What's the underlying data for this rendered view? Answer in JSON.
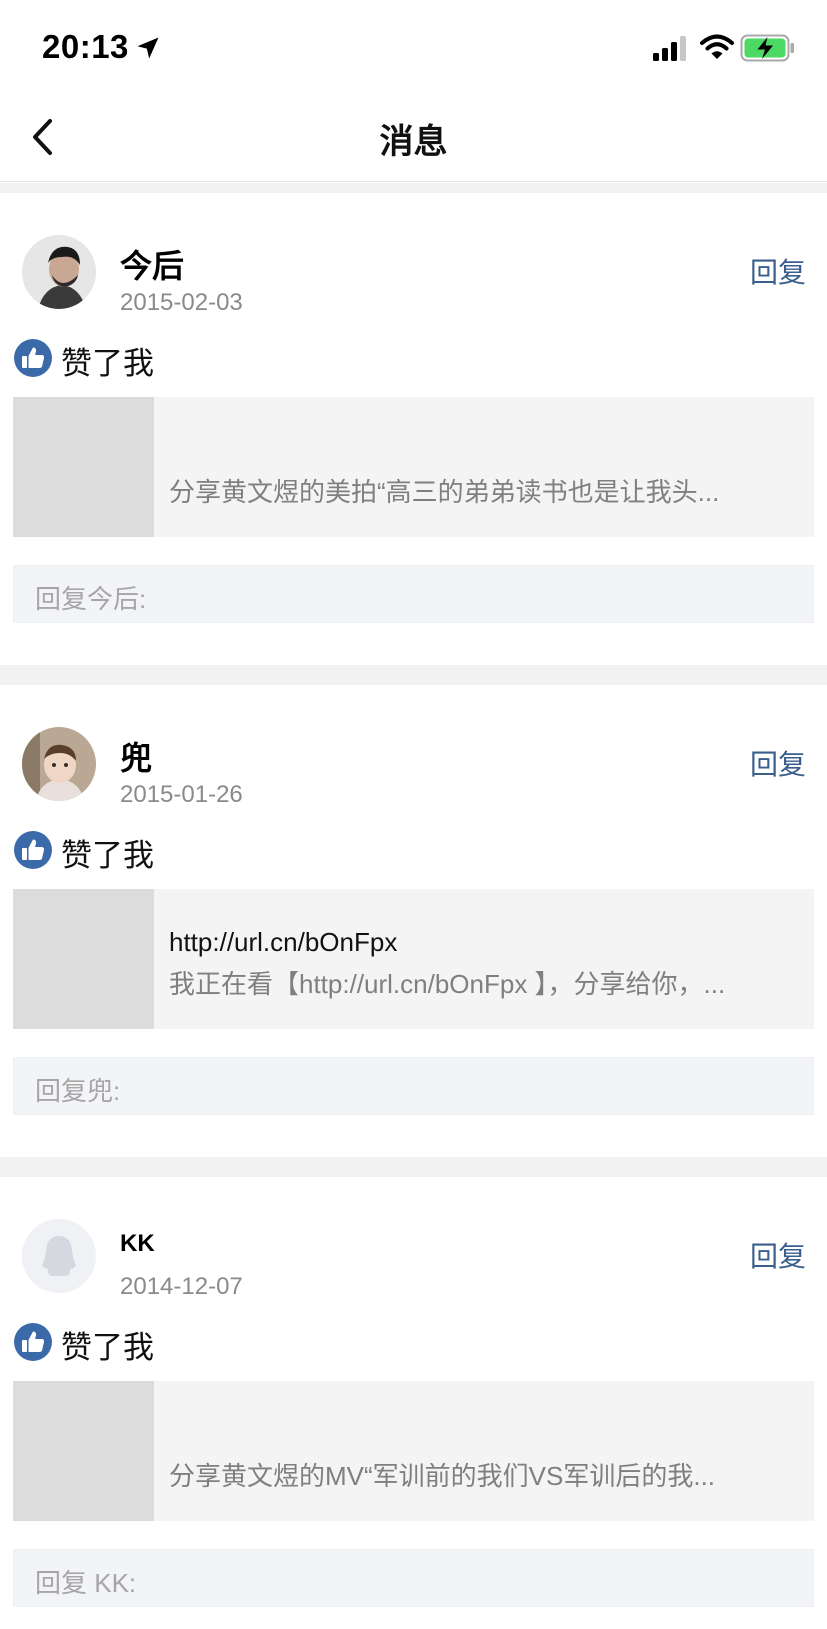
{
  "status_bar": {
    "time": "20:13",
    "icons": [
      "location-arrow-icon",
      "cellular-signal-icon",
      "wifi-icon",
      "battery-charging-icon"
    ],
    "battery_color": "#4cd964"
  },
  "nav": {
    "title": "消息",
    "back_icon": "chevron-left-icon"
  },
  "colors": {
    "accent_blue": "#3b5f8c",
    "like_badge": "#3a6aa8",
    "divider": "#f2f2f2"
  },
  "messages": [
    {
      "name": "今后",
      "date": "2015-02-03",
      "reply_label": "回复",
      "action": "赞了我",
      "share_title": "",
      "share_desc": "分享黄文煜的美拍“高三的弟弟读书也是让我头...",
      "reply_placeholder": "回复今后:"
    },
    {
      "name": "兜",
      "date": "2015-01-26",
      "reply_label": "回复",
      "action": "赞了我",
      "share_title": "http://url.cn/bOnFpx",
      "share_desc": "我正在看【http://url.cn/bOnFpx 】，分享给你，...",
      "reply_placeholder": "回复兜:"
    },
    {
      "name": "KK",
      "date": "2014-12-07",
      "reply_label": "回复",
      "action": "赞了我",
      "share_title": "",
      "share_desc": "分享黄文煜的MV“军训前的我们VS军训后的我...",
      "reply_placeholder": "回复 KK:"
    }
  ]
}
